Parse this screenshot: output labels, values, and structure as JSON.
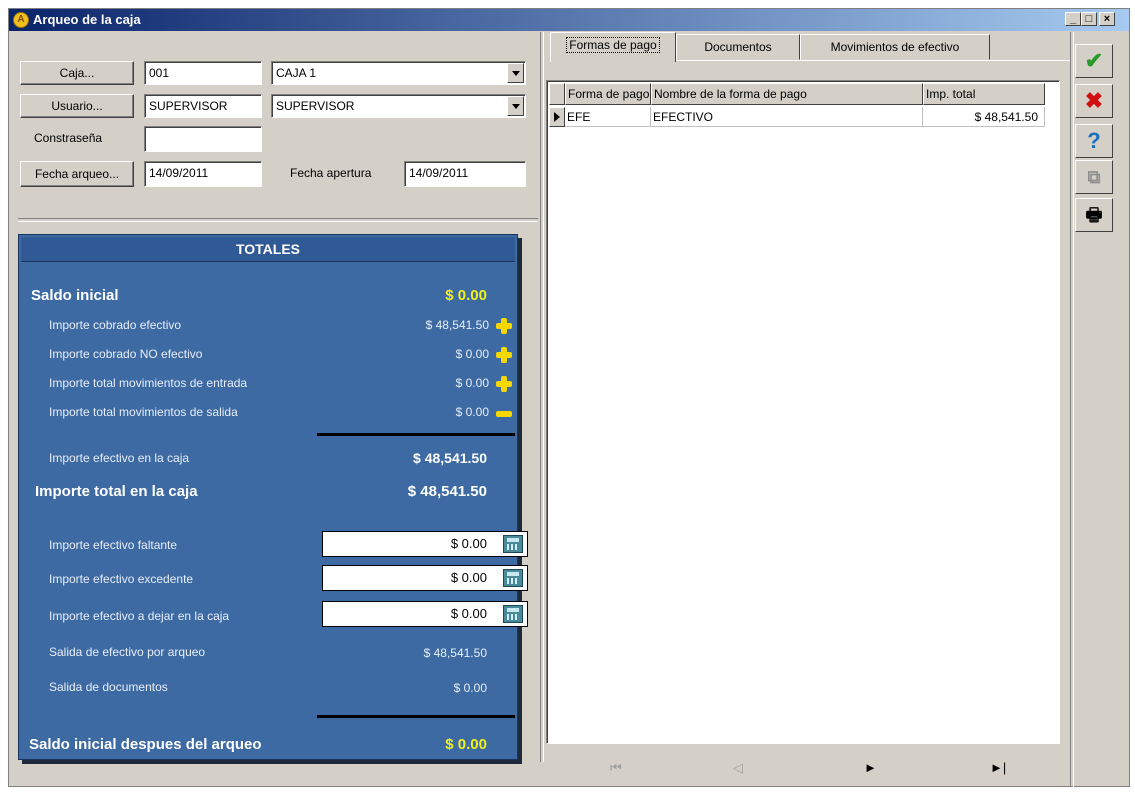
{
  "window": {
    "title": "Arqueo de la caja",
    "controls": {
      "minimize": "_",
      "maximize": "□",
      "close": "×"
    }
  },
  "header_form": {
    "caja_button": "Caja...",
    "caja_code": "001",
    "caja_name": "CAJA 1",
    "usuario_button": "Usuario...",
    "usuario_code": "SUPERVISOR",
    "usuario_name": "SUPERVISOR",
    "password_label": "Constraseña",
    "password_value": "",
    "fecha_arqueo_button": "Fecha arqueo...",
    "fecha_arqueo_value": "14/09/2011",
    "fecha_apertura_label": "Fecha apertura",
    "fecha_apertura_value": "14/09/2011"
  },
  "totales": {
    "title": "TOTALES",
    "saldo_inicial_label": "Saldo inicial",
    "saldo_inicial_value": "$ 0.00",
    "rows": [
      {
        "label": "Importe cobrado efectivo",
        "value": "$ 48,541.50",
        "sign": "plus"
      },
      {
        "label": "Importe cobrado NO efectivo",
        "value": "$ 0.00",
        "sign": "plus"
      },
      {
        "label": "Importe total movimientos de entrada",
        "value": "$ 0.00",
        "sign": "plus"
      },
      {
        "label": "Importe total movimientos de salida",
        "value": "$ 0.00",
        "sign": "minus"
      }
    ],
    "efectivo_caja_label": "Importe efectivo en la caja",
    "efectivo_caja_value": "$ 48,541.50",
    "total_caja_label": "Importe total en la caja",
    "total_caja_value": "$ 48,541.50",
    "faltante_label": "Importe efectivo faltante",
    "faltante_value": "$ 0.00",
    "excedente_label": "Importe efectivo excedente",
    "excedente_value": "$ 0.00",
    "dejar_label": "Importe efectivo a dejar en la caja",
    "dejar_value": "$ 0.00",
    "salida_efectivo_label": "Salida de efectivo por arqueo",
    "salida_efectivo_value": "$ 48,541.50",
    "salida_docs_label": "Salida de documentos",
    "salida_docs_value": "$ 0.00",
    "saldo_final_label": "Saldo inicial despues del arqueo",
    "saldo_final_value": "$ 0.00"
  },
  "tabs": [
    {
      "label": "Formas de pago",
      "active": true
    },
    {
      "label": "Documentos",
      "active": false
    },
    {
      "label": "Movimientos de efectivo",
      "active": false
    }
  ],
  "grid": {
    "columns": [
      "Forma de pago",
      "Nombre de la forma de pago",
      "Imp. total"
    ],
    "rows": [
      {
        "code": "EFE",
        "name": "EFECTIVO",
        "total": "$ 48,541.50"
      }
    ]
  },
  "navigator": {
    "first": "⏮",
    "prev": "◁",
    "next": "►",
    "last": "►|"
  },
  "toolbar": {
    "accept": "✔",
    "cancel": "✖",
    "help": "?",
    "copy": "⧉",
    "print": "🖶"
  },
  "colors": {
    "panel_bg": "#3d6aa3",
    "accent_yellow": "#f0f020",
    "title_bar": "#0a246a"
  }
}
